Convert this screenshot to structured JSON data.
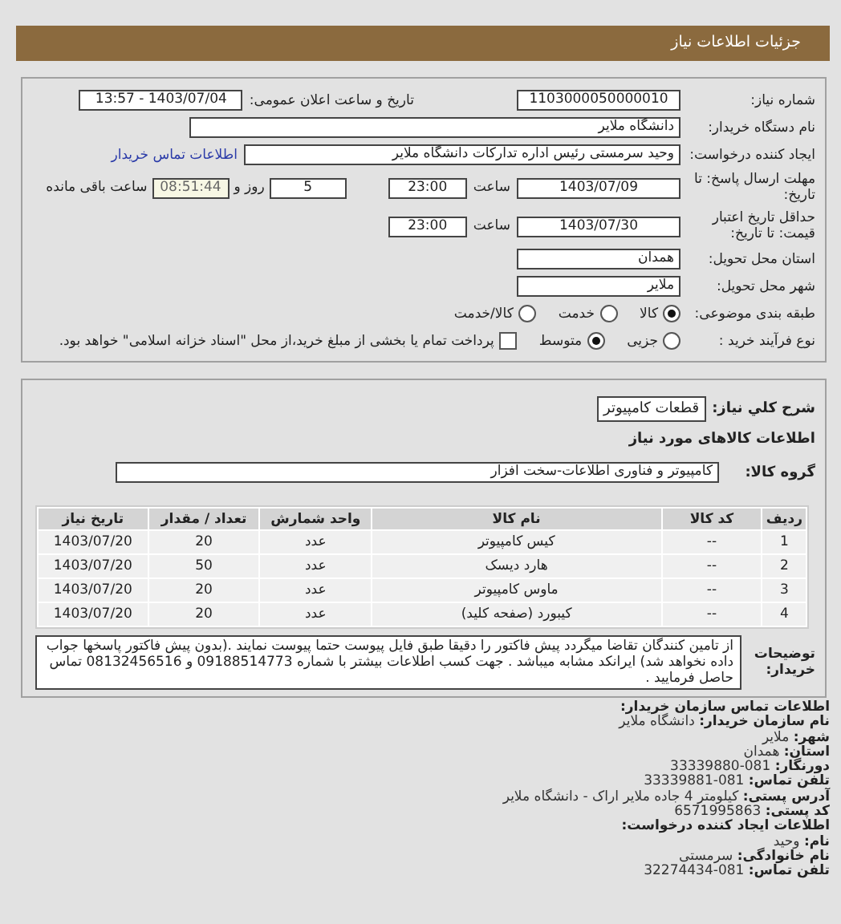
{
  "header": {
    "title": "جزئیات اطلاعات نیاز"
  },
  "request": {
    "need_number": {
      "label": "شماره نیاز:",
      "value": "1103000050000010"
    },
    "announce": {
      "label": "تاریخ و ساعت اعلان عمومی:",
      "value": "1403/07/04 - 13:57"
    },
    "buyer": {
      "label": "نام دستگاه خریدار:",
      "value": "دانشگاه ملایر"
    },
    "requester": {
      "label": "ایجاد کننده درخواست:",
      "value": "وحید سرمستی رئیس اداره تدارکات دانشگاه ملایر",
      "link": "اطلاعات تماس خریدار"
    },
    "reply_deadline": {
      "label": "مهلت ارسال پاسخ: تا تاریخ:",
      "date": "1403/07/09",
      "time_label": "ساعت",
      "time": "23:00",
      "days": "5",
      "days_label": "روز و",
      "remaining": "08:51:44",
      "remaining_label": "ساعت باقی مانده"
    },
    "price_validity": {
      "label": "حداقل تاریخ اعتبار قیمت: تا تاریخ:",
      "date": "1403/07/30",
      "time_label": "ساعت",
      "time": "23:00"
    },
    "province": {
      "label": "استان محل تحویل:",
      "value": "همدان"
    },
    "city": {
      "label": "شهر محل تحویل:",
      "value": "ملایر"
    },
    "category": {
      "label": "طبقه بندی موضوعی:",
      "options": [
        {
          "label": "کالا",
          "selected": true
        },
        {
          "label": "خدمت",
          "selected": false
        },
        {
          "label": "کالا/خدمت",
          "selected": false
        }
      ]
    },
    "purchase_process": {
      "label": "نوع فرآیند خرید :",
      "options": [
        {
          "label": "جزیی",
          "selected": false
        },
        {
          "label": "متوسط",
          "selected": true
        }
      ],
      "payment": {
        "label": "پرداخت تمام یا بخشی از مبلغ خرید،از محل \"اسناد خزانه اسلامی\" خواهد بود.",
        "checked": false
      }
    }
  },
  "goods": {
    "description": {
      "label": "شرح کلي نیاز:",
      "value": "قطعات کامپیوتر"
    },
    "title": "اطلاعات کالاهای مورد نیاز",
    "group": {
      "label": "گروه کالا:",
      "value": "کامپیوتر و فناوری اطلاعات-سخت افزار"
    },
    "table": {
      "columns": [
        "ردیف",
        "کد کالا",
        "نام کالا",
        "واحد شمارش",
        "تعداد / مقدار",
        "تاریخ نیاز"
      ],
      "rows": [
        [
          "1",
          "--",
          "کیس کامپیوتر",
          "عدد",
          "20",
          "1403/07/20"
        ],
        [
          "2",
          "--",
          "هارد دیسک",
          "عدد",
          "50",
          "1403/07/20"
        ],
        [
          "3",
          "--",
          "ماوس کامپیوتر",
          "عدد",
          "20",
          "1403/07/20"
        ],
        [
          "4",
          "--",
          "کیبورد (صفحه کلید)",
          "عدد",
          "20",
          "1403/07/20"
        ]
      ]
    },
    "notes": {
      "label": "توضیحات خریدار:",
      "text": "از تامین کنندگان تقاضا میگردد پیش فاکتور را دقیقا طبق فایل پیوست حتما پیوست نمایند .(بدون پیش فاکتور پاسخها جواب داده نخواهد شد) ایرانکد مشابه میباشد . جهت کسب اطلاعات بیشتر با شماره 09188514773 و 08132456516 تماس حاصل فرمایید ."
    }
  },
  "contact": {
    "lines": [
      {
        "kind": "heading",
        "label": "اطلاعات تماس سازمان خریدار:"
      },
      {
        "kind": "field",
        "label": "نام سازمان خریدار:",
        "value": "دانشگاه ملایر"
      },
      {
        "kind": "field",
        "label": "شهر:",
        "value": "ملایر"
      },
      {
        "kind": "field",
        "label": "استان:",
        "value": "همدان"
      },
      {
        "kind": "field",
        "label": "دورنگار:",
        "value": "081-33339880"
      },
      {
        "kind": "field",
        "label": "تلفن تماس:",
        "value": "081-33339881"
      },
      {
        "kind": "field",
        "label": "آدرس پستی:",
        "value": "کیلومتر 4 جاده ملایر اراک - دانشگاه ملایر"
      },
      {
        "kind": "field",
        "label": "کد پستی:",
        "value": "6571995863"
      },
      {
        "kind": "heading",
        "label": "اطلاعات ایجاد کننده درخواست:"
      },
      {
        "kind": "field",
        "label": "نام:",
        "value": "وحید"
      },
      {
        "kind": "field",
        "label": "نام خانوادگی:",
        "value": "سرمستی"
      },
      {
        "kind": "field",
        "label": "تلفن تماس:",
        "value": "081-32274434"
      }
    ]
  }
}
